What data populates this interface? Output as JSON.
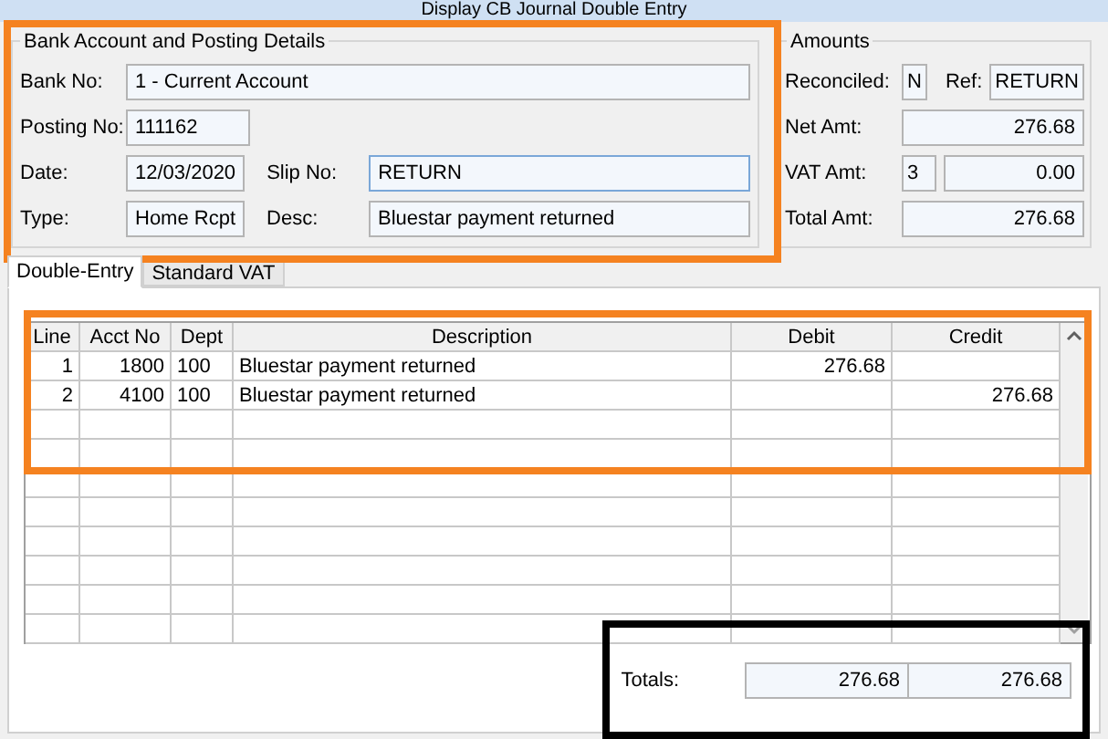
{
  "window": {
    "title": "Display CB Journal Double Entry"
  },
  "bank_details": {
    "title": "Bank Account and Posting Details",
    "bank_no": {
      "label": "Bank No:",
      "value": "1 - Current Account"
    },
    "posting_no": {
      "label": "Posting No:",
      "value": "111162"
    },
    "date": {
      "label": "Date:",
      "value": "12/03/2020"
    },
    "slip_no": {
      "label": "Slip No:",
      "value": "RETURN"
    },
    "type": {
      "label": "Type:",
      "value": "Home Rcpt"
    },
    "desc": {
      "label": "Desc:",
      "value": "Bluestar payment returned"
    }
  },
  "amounts": {
    "title": "Amounts",
    "reconciled": {
      "label": "Reconciled:",
      "value": "N"
    },
    "ref": {
      "label": "Ref:",
      "value": "RETURN"
    },
    "net_amt": {
      "label": "Net Amt:",
      "value": "276.68"
    },
    "vat_amt": {
      "label": "VAT Amt:",
      "code": "3",
      "value": "0.00"
    },
    "total_amt": {
      "label": "Total Amt:",
      "value": "276.68"
    }
  },
  "tabs": [
    {
      "label": "Double-Entry",
      "selected": true
    },
    {
      "label": "Standard VAT",
      "selected": false
    }
  ],
  "table": {
    "columns": [
      "Line",
      "Acct No",
      "Dept",
      "Description",
      "Debit",
      "Credit"
    ],
    "rows": [
      [
        "1",
        "1800",
        "100",
        "Bluestar payment returned",
        "276.68",
        ""
      ],
      [
        "2",
        "4100",
        "100",
        "Bluestar payment returned",
        "",
        "276.68"
      ]
    ]
  },
  "totals": {
    "label": "Totals:",
    "debit": "276.68",
    "credit": "276.68"
  }
}
